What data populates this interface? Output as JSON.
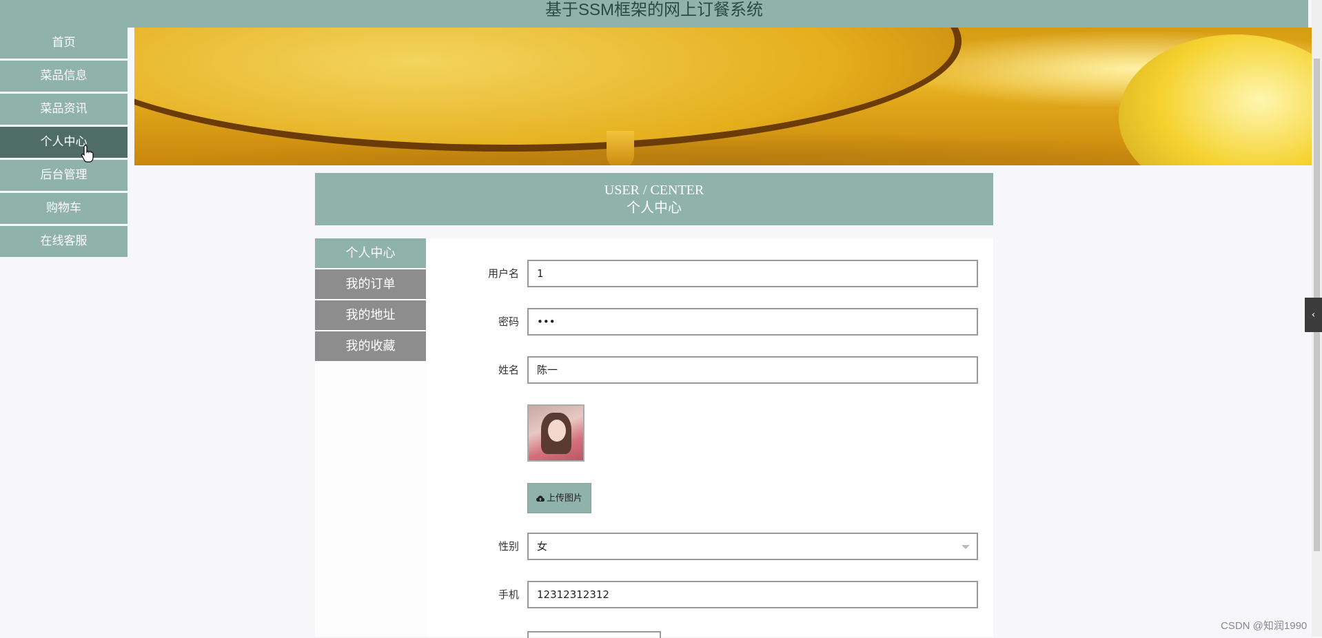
{
  "app": {
    "title": "基于SSM框架的网上订餐系统"
  },
  "sidebar": {
    "items": [
      {
        "label": "首页"
      },
      {
        "label": "菜品信息"
      },
      {
        "label": "菜品资讯"
      },
      {
        "label": "个人中心"
      },
      {
        "label": "后台管理"
      },
      {
        "label": "购物车"
      },
      {
        "label": "在线客服"
      }
    ]
  },
  "header": {
    "en": "USER / CENTER",
    "zh": "个人中心"
  },
  "subnav": {
    "items": [
      {
        "label": "个人中心"
      },
      {
        "label": "我的订单"
      },
      {
        "label": "我的地址"
      },
      {
        "label": "我的收藏"
      }
    ]
  },
  "form": {
    "username": {
      "label": "用户名",
      "value": "1"
    },
    "password": {
      "label": "密码",
      "value": "•••"
    },
    "name": {
      "label": "姓名",
      "value": "陈一"
    },
    "upload_label": "上传图片",
    "gender": {
      "label": "性别",
      "value": "女"
    },
    "phone": {
      "label": "手机",
      "value": "12312312312"
    }
  },
  "side_tab": {
    "glyph": "‹"
  },
  "watermark": "CSDN @知润1990",
  "colors": {
    "accent": "#8fb2aa",
    "accent_dark": "#4f6c67",
    "subnav_inactive": "#8d8d8d"
  }
}
